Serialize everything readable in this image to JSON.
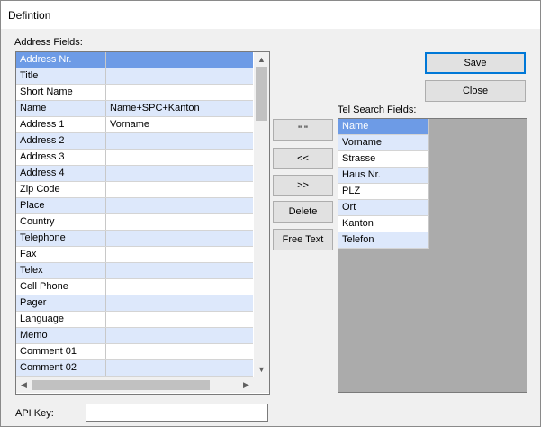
{
  "window": {
    "title": "Defintion"
  },
  "address": {
    "label": "Address Fields:",
    "rows": [
      {
        "name": "Address Nr.",
        "value": "",
        "selected": true
      },
      {
        "name": "Title",
        "value": ""
      },
      {
        "name": "Short Name",
        "value": ""
      },
      {
        "name": "Name",
        "value": "Name+SPC+Kanton"
      },
      {
        "name": "Address 1",
        "value": "Vorname"
      },
      {
        "name": "Address 2",
        "value": ""
      },
      {
        "name": "Address 3",
        "value": ""
      },
      {
        "name": "Address 4",
        "value": ""
      },
      {
        "name": "Zip Code",
        "value": ""
      },
      {
        "name": "Place",
        "value": ""
      },
      {
        "name": "Country",
        "value": ""
      },
      {
        "name": "Telephone",
        "value": ""
      },
      {
        "name": "Fax",
        "value": ""
      },
      {
        "name": "Telex",
        "value": ""
      },
      {
        "name": "Cell Phone",
        "value": ""
      },
      {
        "name": "Pager",
        "value": ""
      },
      {
        "name": "Language",
        "value": ""
      },
      {
        "name": "Memo",
        "value": ""
      },
      {
        "name": "Comment 01",
        "value": ""
      },
      {
        "name": "Comment 02",
        "value": ""
      }
    ],
    "scroll_up_icon": "triangle-up-icon",
    "scroll_down_icon": "triangle-down-icon",
    "scroll_left_icon": "triangle-left-icon",
    "scroll_right_icon": "triangle-right-icon"
  },
  "middle": {
    "quote_label": "\" \"",
    "move_left_label": "<<",
    "move_right_label": ">>",
    "delete_label": "Delete",
    "freetext_label": "Free Text"
  },
  "actions": {
    "save_label": "Save",
    "close_label": "Close"
  },
  "tel": {
    "label": "Tel Search Fields:",
    "items": [
      {
        "name": "Name",
        "selected": true
      },
      {
        "name": "Vorname"
      },
      {
        "name": "Strasse"
      },
      {
        "name": "Haus Nr."
      },
      {
        "name": "PLZ"
      },
      {
        "name": "Ort"
      },
      {
        "name": "Kanton"
      },
      {
        "name": "Telefon"
      }
    ]
  },
  "api": {
    "label": "API Key:",
    "value": ""
  },
  "colors": {
    "selection": "#6d9be6",
    "alt_row": "#dde8fb",
    "default_button_border": "#0078d7",
    "list_background": "#ababab"
  }
}
